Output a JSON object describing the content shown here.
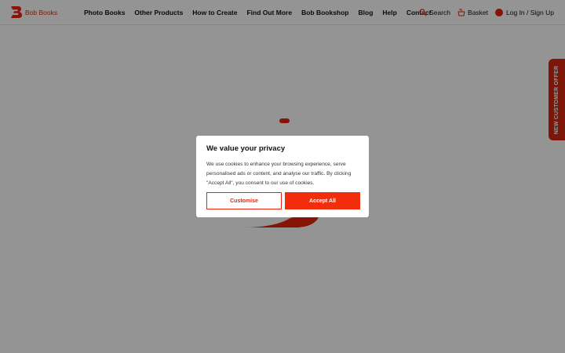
{
  "brand": {
    "name": "Bob Books",
    "accent": "#e8250c"
  },
  "nav": {
    "items": [
      {
        "label": "Photo Books"
      },
      {
        "label": "Other Products"
      },
      {
        "label": "How to Create"
      },
      {
        "label": "Find Out More"
      },
      {
        "label": "Bob Bookshop"
      },
      {
        "label": "Blog"
      },
      {
        "label": "Help"
      },
      {
        "label": "Contact"
      }
    ]
  },
  "utils": {
    "search": {
      "label": "Search",
      "icon": "search-icon"
    },
    "basket": {
      "label": "Basket",
      "icon": "basket-icon"
    },
    "account": {
      "label": "Log In / Sign Up",
      "icon": "user-icon"
    }
  },
  "side_tab": {
    "label": "NEW CUSTOMER OFFER"
  },
  "cookie_modal": {
    "title": "We value your privacy",
    "body": "We use cookies to enhance your browsing experience, serve personalised ads or content, and analyse our traffic. By clicking \"Accept All\", you consent to our use of cookies.",
    "customise_label": "Customise",
    "accept_label": "Accept All"
  }
}
